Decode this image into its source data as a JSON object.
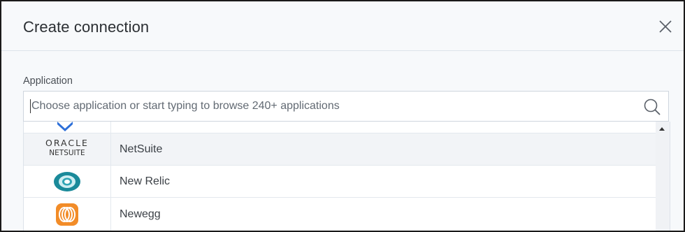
{
  "dialog": {
    "title": "Create connection",
    "close_icon": "close-icon"
  },
  "application_field": {
    "label": "Application",
    "placeholder": "Choose application or start typing to browse 240+ applications",
    "value": "",
    "icon": "search-icon"
  },
  "results": [
    {
      "name": "",
      "logo": "partial-blue-logo-icon",
      "partially_visible": true
    },
    {
      "name": "NetSuite",
      "logo": "oracle-netsuite-logo",
      "logo_text": [
        "ORACLE",
        "NETSUITE"
      ],
      "highlighted": true
    },
    {
      "name": "New Relic",
      "logo": "new-relic-logo-icon"
    },
    {
      "name": "Newegg",
      "logo": "newegg-logo-icon"
    }
  ],
  "colors": {
    "dialog_bg": "#f7f9fb",
    "highlight_row": "#f2f4f7",
    "new_relic_teal": "#1a8a9a",
    "newegg_orange": "#f28c28",
    "partial_logo_blue": "#2d6fd8"
  }
}
